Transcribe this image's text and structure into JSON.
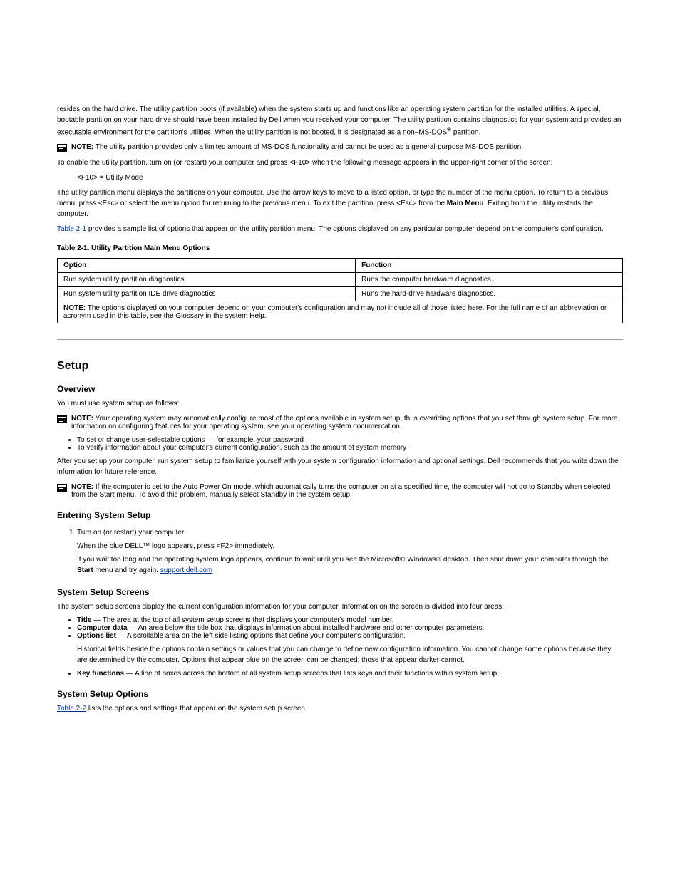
{
  "page": {
    "intro_para": "resides on the hard drive. The utility partition boots (if available) when the system starts up and functions like an operating system partition for the installed utilities. A special, bootable partition on your hard drive should have been installed by Dell when you received your computer. The utility partition contains diagnostics for your system and provides an executable environment for the partition's utilities. When the utility partition is not booted, it is designated as a non–MS-DOS",
    "intro_trail": " partition.",
    "reg": "®",
    "note1_label": "NOTE:",
    "note1_text": " The utility partition provides only a limited amount of MS-DOS functionality and cannot be used as a general-purpose MS-DOS partition.",
    "enable_para": "To enable the utility partition, turn on (or restart) your computer and press <F10> when the following message appears in the upper-right corner of the screen:",
    "enable_code": "<F10> = Utility Mode",
    "menu_para_1": "The utility partition menu displays the partitions on your computer. Use the arrow keys to move to a listed option, or type the number of the menu option. To return to a previous menu, press <Esc> or select the menu option for returning to the previous menu. To exit the partition, press <Esc> from the ",
    "menu_para_bold": "Main Menu",
    "menu_para_2": ". Exiting from the utility restarts the computer.",
    "table_link": "Table 2-1",
    "table_tail": " provides a sample list of options that appear on the utility partition menu. The options displayed on any particular computer depend on the computer's configuration.",
    "table_caption": "Table 2-1. Utility Partition Main Menu Options",
    "table": {
      "h1": "Option",
      "h2": "Function",
      "r1c1": "Run system utility partition diagnostics",
      "r1c2": "Runs the computer hardware diagnostics.",
      "r2c1": "Run system utility partition IDE drive diagnostics",
      "r2c2": "Runs the hard-drive hardware diagnostics.",
      "note_label": "NOTE:",
      "note_text": " The options displayed on your computer depend on your computer's configuration and may not include all of those listed here. For the full name of an abbreviation or acronym used in this table, see the Glossary in the system Help."
    }
  },
  "setup": {
    "title": "Setup",
    "overview_h": "Overview",
    "overview_p": "You must use system setup as follows:",
    "note2_label": "NOTE:",
    "note2_text": " Your operating system may automatically configure most of the options available in system setup, thus overriding options that you set through system setup. For more information on configuring features for your operating system, see your operating system documentation.",
    "bul1": "To set or change user-selectable options — for example, your password",
    "bul2": "To verify information about your computer's current configuration, such as the amount of system memory",
    "after_p": "After you set up your computer, run system setup to familiarize yourself with your system configuration information and optional settings. Dell recommends that you write down the information for future reference.",
    "note3_label": "NOTE:",
    "note3_text": " If the computer is set to the Auto Power On mode, which automatically turns the computer on at a specified time, the computer will not go to Standby when selected from the Start menu. To avoid this problem, manually select Standby in the system setup.",
    "enter_h": "Entering System Setup",
    "enter_s1_a": "Turn on (or restart) your computer.",
    "enter_s1_b_1": "When the blue DELL™ logo appears, press <F2> immediately.",
    "enter_s1_b_2": "If you wait too long and the operating system logo appears, continue to wait until you see the Microsoft® Windows® desktop. Then shut down your computer through the ",
    "enter_s1_b_bold": "Start",
    "enter_s1_b_3": " menu and try again.",
    "screens_h": "System Setup Screens",
    "screens_p1": "The system setup screens display the current configuration information for your computer. Information on the screen is divided into four areas:",
    "title_b": "Title",
    "title_t": " — The area at the top of all system setup screens that displays your computer's model number.",
    "data_b": "Computer data",
    "data_t": " — An area below the title box that displays information about installed hardware and other computer parameters.",
    "link_text": "support.dell.com",
    "options_b": "Options list",
    "options_t": " — A scrollable area on the left side listing options that define your computer's configuration.",
    "options_p2": "Historical fields beside the options contain settings or values that you can change to define new configuration information. You cannot change some options because they are determined by the computer. Options that appear blue on the screen can be changed; those that appear darker cannot.",
    "key_b": "Key functions",
    "key_t": " — A line of boxes across the bottom of all system setup screens that lists keys and their functions within system setup.",
    "opts_h": "System Setup Options",
    "opts_link": "Table 2-2",
    "opts_tail": " lists the options and settings that appear on the system setup screen."
  }
}
